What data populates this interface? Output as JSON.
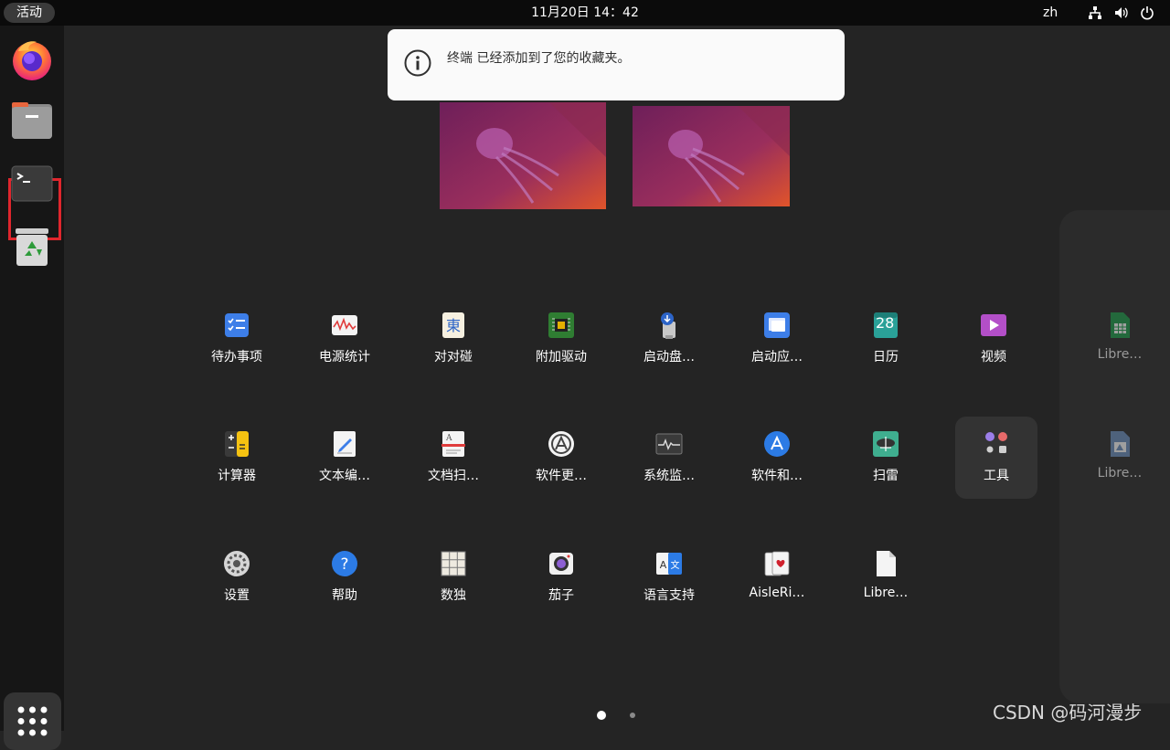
{
  "topbar": {
    "activities": "活动",
    "clock": "11月20日  14：42",
    "lang": "zh"
  },
  "dock": {
    "items": [
      {
        "name": "firefox-icon"
      },
      {
        "name": "files-icon"
      },
      {
        "name": "terminal-icon",
        "highlighted": true
      },
      {
        "name": "trash-icon"
      }
    ],
    "show_apps_icon": "grid-icon"
  },
  "notification": {
    "text": "终端 已经添加到了您的收藏夹。",
    "icon": "info-icon"
  },
  "apps": {
    "row1": [
      "待办事项",
      "电源统计",
      "对对碰",
      "附加驱动",
      "启动盘…",
      "启动应…",
      "日历",
      "视频"
    ],
    "row2": [
      "计算器",
      "文本编…",
      "文档扫…",
      "软件更…",
      "系统监…",
      "软件和…",
      "扫雷",
      "工具"
    ],
    "row3": [
      "设置",
      "帮助",
      "数独",
      "茄子",
      "语言支持",
      "AisleRi…",
      "Libre…"
    ],
    "next_page": [
      "Libre…",
      "Libre…"
    ],
    "calendar_day": "28"
  },
  "colors": {
    "topbar": "#0b0b0b",
    "dock": "#161616",
    "background": "#242424",
    "highlight": "#e0262d"
  },
  "watermark": "CSDN @码河漫步"
}
